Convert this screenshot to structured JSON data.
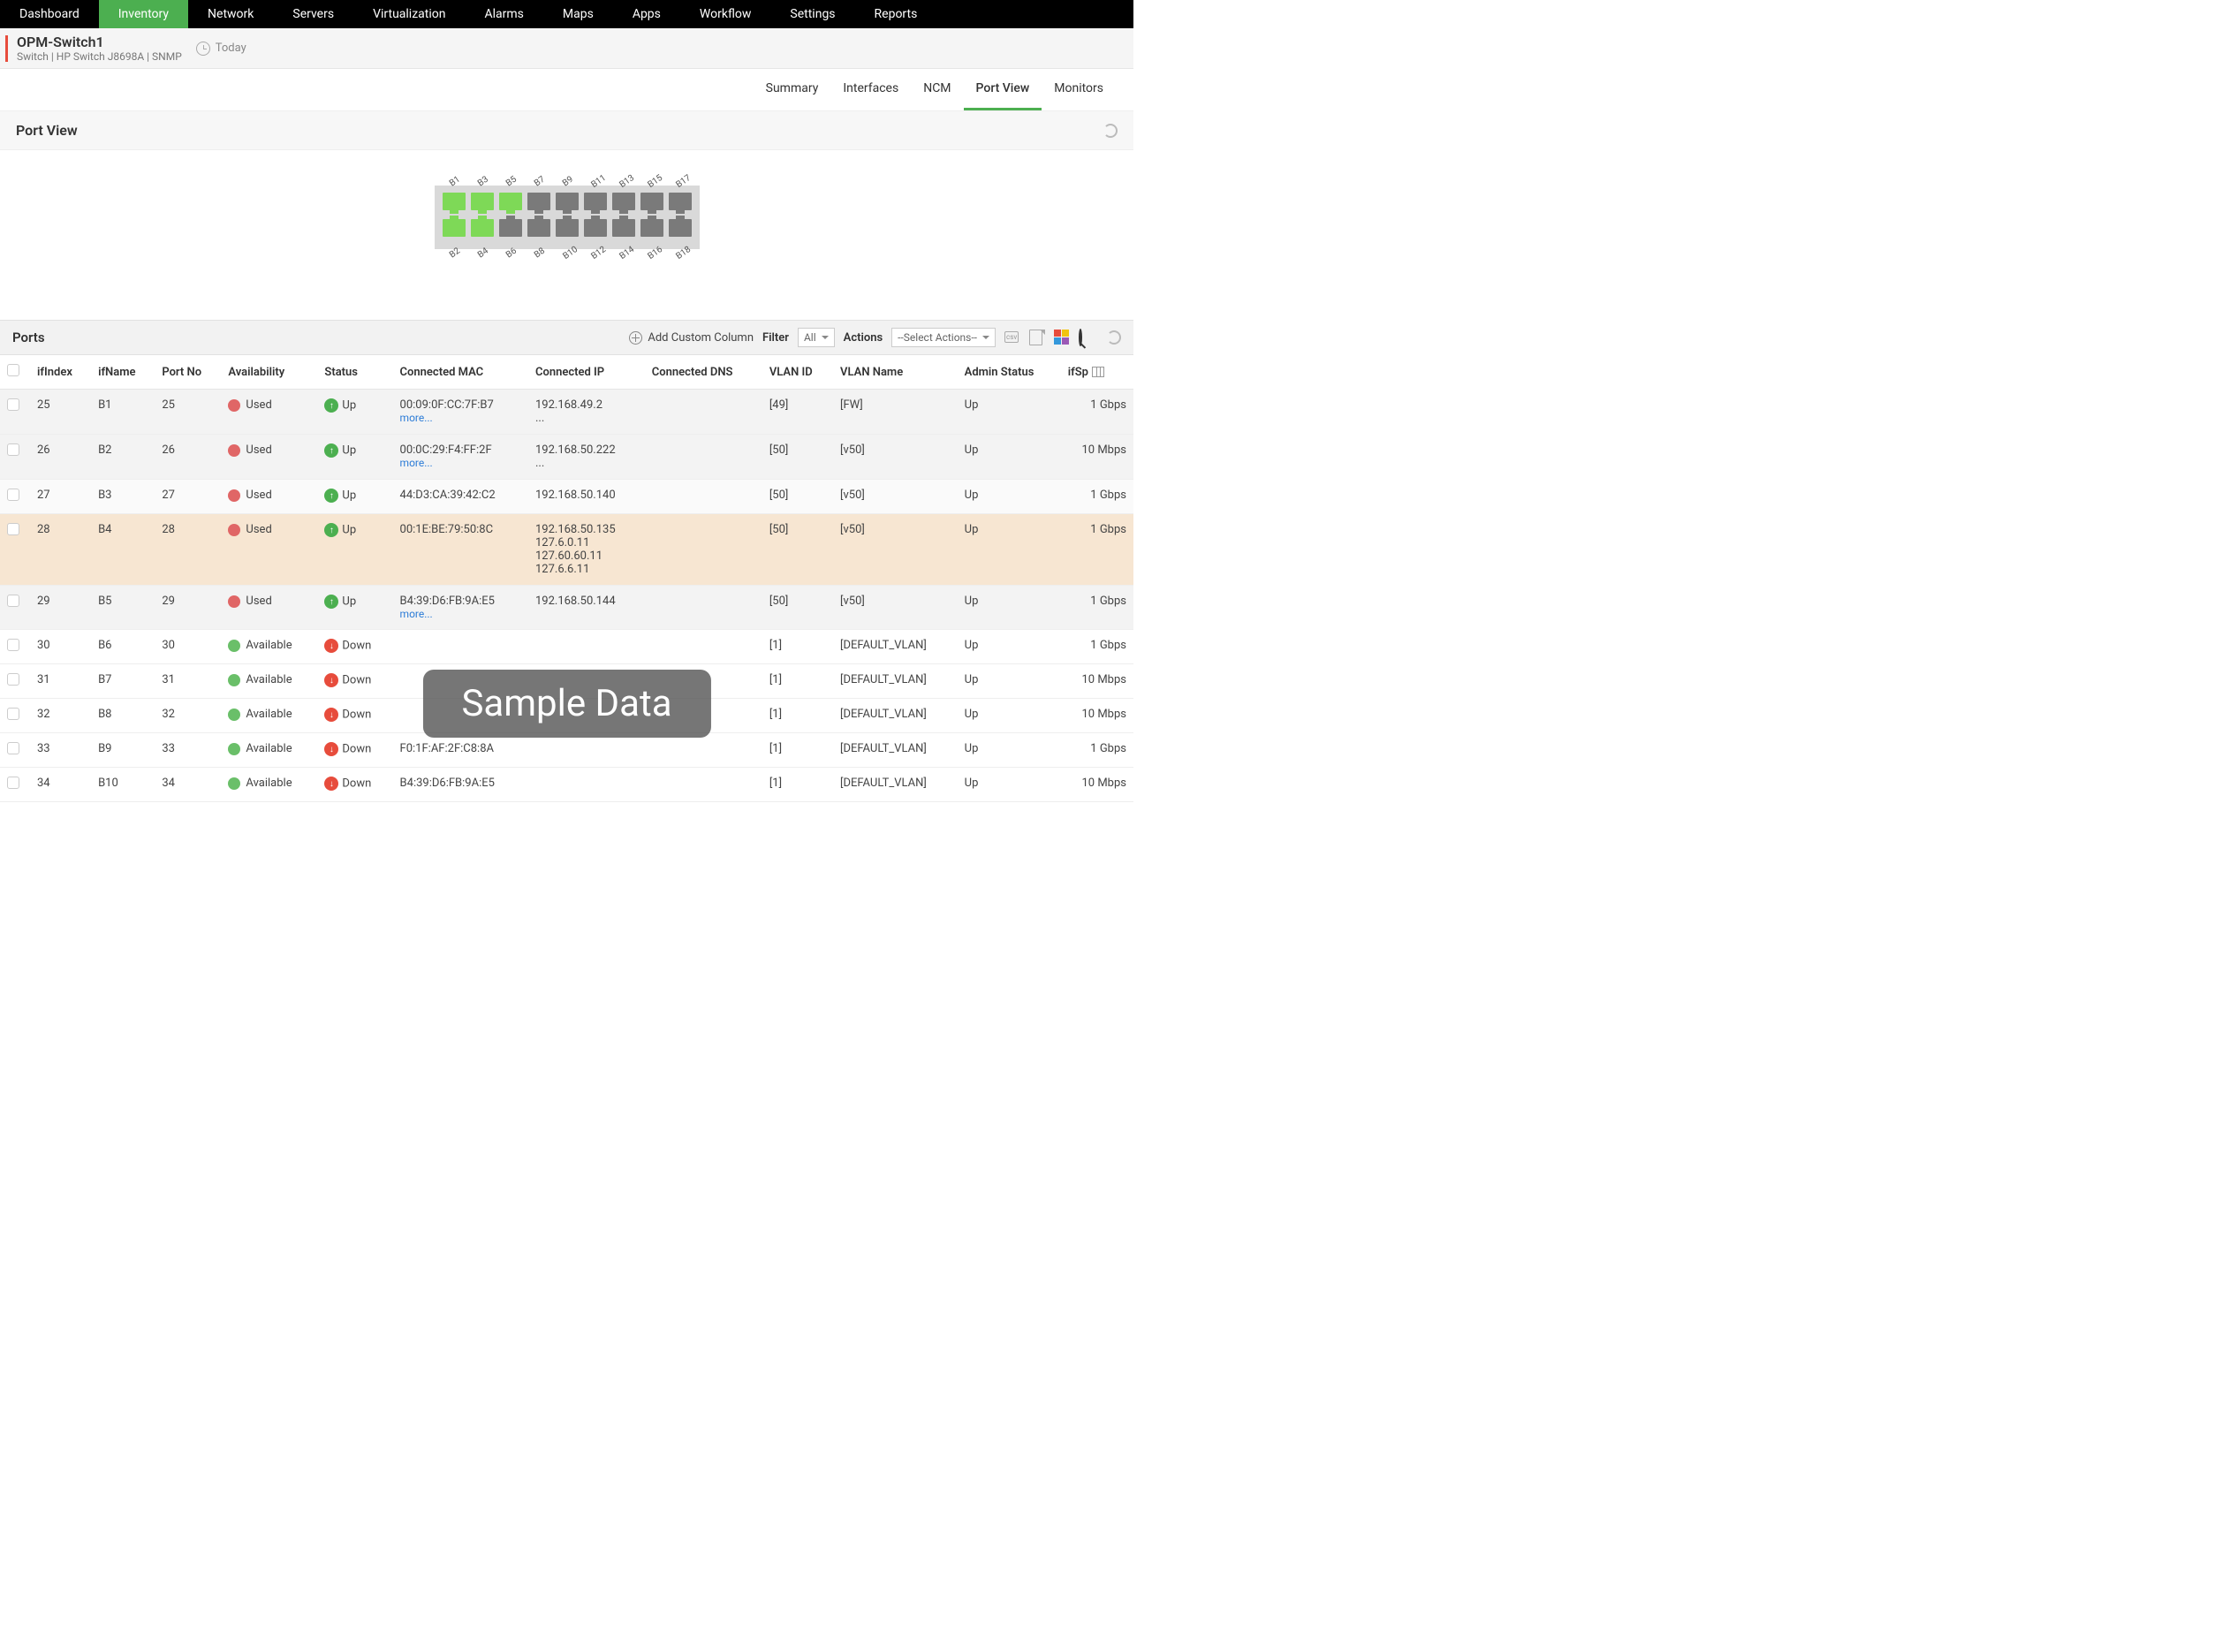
{
  "nav": {
    "items": [
      "Dashboard",
      "Inventory",
      "Network",
      "Servers",
      "Virtualization",
      "Alarms",
      "Maps",
      "Apps",
      "Workflow",
      "Settings",
      "Reports"
    ],
    "active": "Inventory"
  },
  "device": {
    "name": "OPM-Switch1",
    "meta": "Switch | HP Switch J8698A  | SNMP",
    "time_label": "Today"
  },
  "subtabs": {
    "items": [
      "Summary",
      "Interfaces",
      "NCM",
      "Port View",
      "Monitors"
    ],
    "active": "Port View"
  },
  "port_view": {
    "title": "Port View",
    "top_ports": [
      {
        "l": "B1",
        "up": true
      },
      {
        "l": "B3",
        "up": true
      },
      {
        "l": "B5",
        "up": true
      },
      {
        "l": "B7",
        "up": false
      },
      {
        "l": "B9",
        "up": false
      },
      {
        "l": "B11",
        "up": false
      },
      {
        "l": "B13",
        "up": false
      },
      {
        "l": "B15",
        "up": false
      },
      {
        "l": "B17",
        "up": false
      }
    ],
    "bottom_ports": [
      {
        "l": "B2",
        "up": true
      },
      {
        "l": "B4",
        "up": true
      },
      {
        "l": "B6",
        "up": false
      },
      {
        "l": "B8",
        "up": false
      },
      {
        "l": "B10",
        "up": false
      },
      {
        "l": "B12",
        "up": false
      },
      {
        "l": "B14",
        "up": false
      },
      {
        "l": "B16",
        "up": false
      },
      {
        "l": "B18",
        "up": false
      }
    ]
  },
  "ports_panel": {
    "title": "Ports",
    "add_col": "Add Custom Column",
    "filter_label": "Filter",
    "filter_value": "All",
    "actions_label": "Actions",
    "actions_value": "--Select Actions--"
  },
  "columns": [
    "ifIndex",
    "ifName",
    "Port No",
    "Availability",
    "Status",
    "Connected MAC",
    "Connected IP",
    "Connected DNS",
    "VLAN ID",
    "VLAN Name",
    "Admin Status",
    "ifSpeed"
  ],
  "rows": [
    {
      "ifIndex": "25",
      "ifName": "B1",
      "portNo": "25",
      "avail": "Used",
      "availDot": "red",
      "status": "Up",
      "mac": "00:09:0F:CC:7F:B7",
      "macMore": true,
      "ip": "192.168.49.2",
      "ipMore": "...",
      "vlanId": "[49]",
      "vlanName": "[FW]",
      "admin": "Up",
      "speed": "1 Gbps",
      "rowClass": "row-grey"
    },
    {
      "ifIndex": "26",
      "ifName": "B2",
      "portNo": "26",
      "avail": "Used",
      "availDot": "red",
      "status": "Up",
      "mac": "00:0C:29:F4:FF:2F",
      "macMore": true,
      "ip": "192.168.50.222",
      "ipMore": "...",
      "vlanId": "[50]",
      "vlanName": "[v50]",
      "admin": "Up",
      "speed": "10 Mbps",
      "rowClass": "row-grey"
    },
    {
      "ifIndex": "27",
      "ifName": "B3",
      "portNo": "27",
      "avail": "Used",
      "availDot": "red",
      "status": "Up",
      "mac": "44:D3:CA:39:42:C2",
      "ip": "192.168.50.140",
      "vlanId": "[50]",
      "vlanName": "[v50]",
      "admin": "Up",
      "speed": "1 Gbps",
      "rowClass": "row-light"
    },
    {
      "ifIndex": "28",
      "ifName": "B4",
      "portNo": "28",
      "avail": "Used",
      "availDot": "red",
      "status": "Up",
      "mac": "00:1E:BE:79:50:8C",
      "ip": "192.168.50.135\n127.6.0.11\n127.60.60.11\n127.6.6.11",
      "vlanId": "[50]",
      "vlanName": "[v50]",
      "admin": "Up",
      "speed": "1 Gbps",
      "rowClass": "row-highlight"
    },
    {
      "ifIndex": "29",
      "ifName": "B5",
      "portNo": "29",
      "avail": "Used",
      "availDot": "red",
      "status": "Up",
      "mac": "B4:39:D6:FB:9A:E5",
      "macMore": true,
      "ip": "192.168.50.144",
      "vlanId": "[50]",
      "vlanName": "[v50]",
      "admin": "Up",
      "speed": "1 Gbps",
      "rowClass": "row-grey"
    },
    {
      "ifIndex": "30",
      "ifName": "B6",
      "portNo": "30",
      "avail": "Available",
      "availDot": "green",
      "status": "Down",
      "mac": "",
      "ip": "",
      "vlanId": "[1]",
      "vlanName": "[DEFAULT_VLAN]",
      "admin": "Up",
      "speed": "1 Gbps",
      "rowClass": ""
    },
    {
      "ifIndex": "31",
      "ifName": "B7",
      "portNo": "31",
      "avail": "Available",
      "availDot": "green",
      "status": "Down",
      "mac": "",
      "ip": "",
      "vlanId": "[1]",
      "vlanName": "[DEFAULT_VLAN]",
      "admin": "Up",
      "speed": "10 Mbps",
      "rowClass": ""
    },
    {
      "ifIndex": "32",
      "ifName": "B8",
      "portNo": "32",
      "avail": "Available",
      "availDot": "green",
      "status": "Down",
      "mac": "",
      "ip": "",
      "vlanId": "[1]",
      "vlanName": "[DEFAULT_VLAN]",
      "admin": "Up",
      "speed": "10 Mbps",
      "rowClass": ""
    },
    {
      "ifIndex": "33",
      "ifName": "B9",
      "portNo": "33",
      "avail": "Available",
      "availDot": "green",
      "status": "Down",
      "mac": "F0:1F:AF:2F:C8:8A",
      "ip": "",
      "vlanId": "[1]",
      "vlanName": "[DEFAULT_VLAN]",
      "admin": "Up",
      "speed": "1 Gbps",
      "rowClass": ""
    },
    {
      "ifIndex": "34",
      "ifName": "B10",
      "portNo": "34",
      "avail": "Available",
      "availDot": "green",
      "status": "Down",
      "mac": "B4:39:D6:FB:9A:E5",
      "ip": "",
      "vlanId": "[1]",
      "vlanName": "[DEFAULT_VLAN]",
      "admin": "Up",
      "speed": "10 Mbps",
      "rowClass": ""
    }
  ],
  "more_text": "more...",
  "watermark": "Sample Data"
}
